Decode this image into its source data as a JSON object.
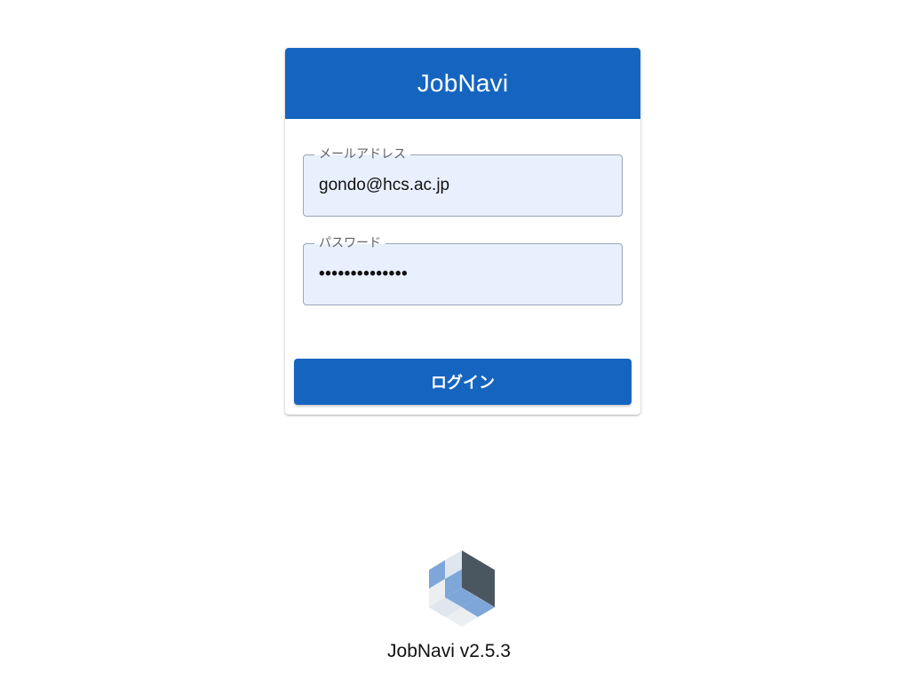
{
  "app": {
    "title": "JobNavi"
  },
  "login_form": {
    "email": {
      "label": "メールアドレス",
      "value": "gondo@hcs.ac.jp"
    },
    "password": {
      "label": "パスワード",
      "masked_value": "••••••••••••••"
    },
    "submit_label": "ログイン"
  },
  "footer": {
    "logo_icon": "cube-logo-icon",
    "version_text": "JobNavi v2.5.3"
  },
  "colors": {
    "primary": "#1565c0",
    "field_background": "#e8f0fe",
    "logo_dark": "#4a5660",
    "logo_light_blue": "#7ea6d8"
  }
}
